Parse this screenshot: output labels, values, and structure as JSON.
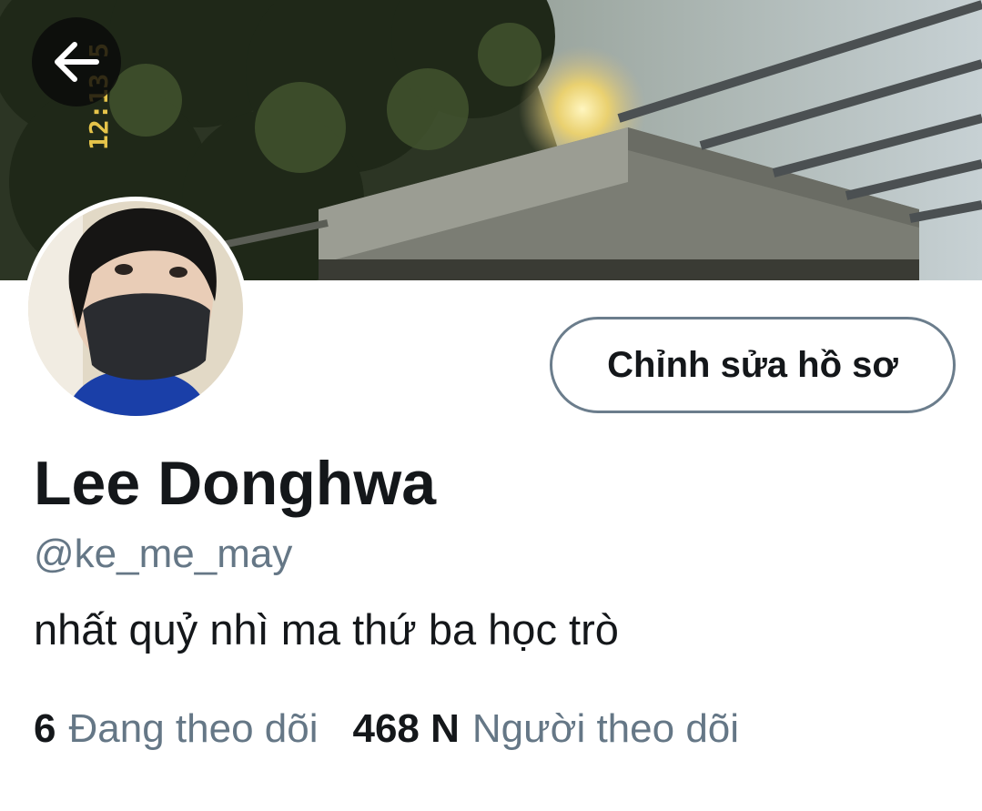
{
  "profile": {
    "display_name": "Lee Donghwa",
    "handle": "@ke_me_may",
    "bio": "nhất quỷ nhì ma thứ ba học trò"
  },
  "header": {
    "back_icon": "arrow-left-icon",
    "banner_stamp": "12:13 5"
  },
  "actions": {
    "edit_profile_label": "Chỉnh sửa hồ sơ"
  },
  "stats": {
    "following_count": "6",
    "following_label": "Đang theo dõi",
    "followers_count": "468 N",
    "followers_label": "Người theo dõi"
  },
  "colors": {
    "text_primary": "#14171a",
    "text_secondary": "#657786",
    "button_border": "#6b7d8c"
  }
}
